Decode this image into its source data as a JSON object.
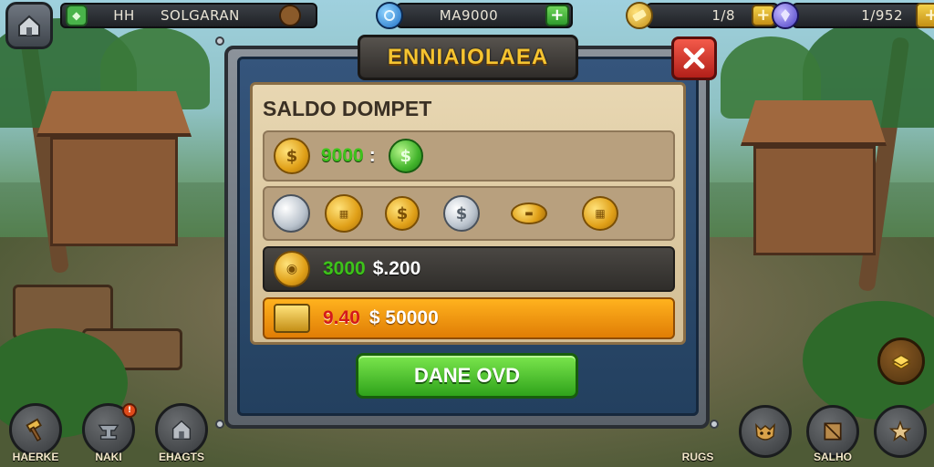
{
  "hud": {
    "player_level": "HH",
    "player_name": "SOLGARAN",
    "crystal_amount": "MA9000",
    "gold_amount": "1/8",
    "gem_amount": "1/952"
  },
  "dialog": {
    "title": "ENNIAIOLAEA",
    "section_title": "SALDO DOMPET",
    "row1": {
      "amount": "9000",
      "separator": ":"
    },
    "row3": {
      "coins": "3000",
      "value": "$.200"
    },
    "row4": {
      "red_value": "9.40",
      "value": "$ 50000"
    },
    "confirm_label": "DANE OVD"
  },
  "bottom_nav": {
    "left": [
      {
        "label": "HAERKE"
      },
      {
        "label": "NAKI",
        "badge": "!"
      },
      {
        "label": "EHAGTS"
      }
    ],
    "right_label": "RUGS",
    "right_buttons": [
      {
        "label": ""
      },
      {
        "label": "SALHO"
      },
      {
        "label": ""
      }
    ]
  },
  "colors": {
    "title_gold": "#f5c431",
    "confirm_green": "#3fb324",
    "close_red": "#d8332a",
    "panel_blue": "#2c4a6e",
    "parchment": "#e0cda6"
  },
  "icons": [
    "home-icon",
    "green-gem-icon",
    "crystal-icon",
    "gold-bar-icon",
    "blue-gem-icon",
    "close-icon",
    "gold-coin-icon",
    "green-coin-icon",
    "silver-coin-icon",
    "gold-stack-icon",
    "hammer-icon",
    "anvil-icon",
    "house-icon",
    "beast-icon",
    "box-icon",
    "star-icon"
  ]
}
